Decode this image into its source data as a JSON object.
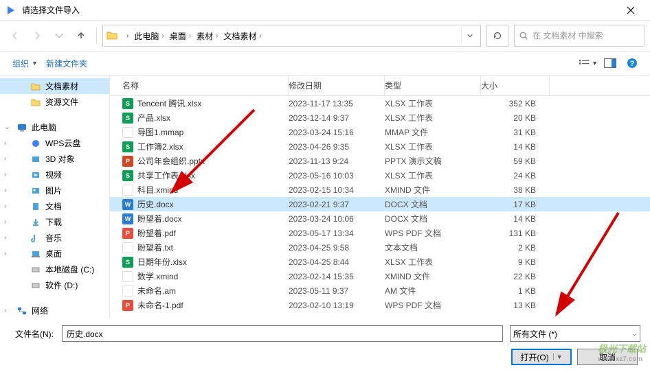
{
  "title": "请选择文件导入",
  "breadcrumb": [
    "此电脑",
    "桌面",
    "素材",
    "文档素材"
  ],
  "search_placeholder": "在 文档素材 中搜索",
  "toolbar": {
    "organize": "组织",
    "new_folder": "新建文件夹"
  },
  "sidebar": {
    "top": [
      {
        "label": "文档素材",
        "icon": "folder",
        "selected": true
      },
      {
        "label": "资源文件",
        "icon": "folder"
      }
    ],
    "pc_label": "此电脑",
    "pc_items": [
      {
        "label": "WPS云盘",
        "color": "#3d7eff"
      },
      {
        "label": "3D 对象",
        "color": "#2b7cd3"
      },
      {
        "label": "视频",
        "color": "#2b7cd3"
      },
      {
        "label": "图片",
        "color": "#2b7cd3"
      },
      {
        "label": "文档",
        "color": "#2b7cd3"
      },
      {
        "label": "下载",
        "color": "#2b7cd3"
      },
      {
        "label": "音乐",
        "color": "#2b7cd3"
      },
      {
        "label": "桌面",
        "color": "#2b7cd3"
      },
      {
        "label": "本地磁盘 (C:)",
        "color": "#888"
      },
      {
        "label": "软件 (D:)",
        "color": "#888"
      }
    ],
    "network_label": "网络"
  },
  "columns": {
    "name": "名称",
    "date": "修改日期",
    "type": "类型",
    "size": "大小"
  },
  "files": [
    {
      "name": "Tencent 腾讯.xlsx",
      "date": "2023-11-17 13:35",
      "type": "XLSX 工作表",
      "size": "352 KB",
      "icon": "xlsx",
      "glyph": "S"
    },
    {
      "name": "产品.xlsx",
      "date": "2023-12-14 9:37",
      "type": "XLSX 工作表",
      "size": "20 KB",
      "icon": "xlsx",
      "glyph": "S"
    },
    {
      "name": "导图1.mmap",
      "date": "2023-03-24 15:16",
      "type": "MMAP 文件",
      "size": "31 KB",
      "icon": "mmap",
      "glyph": ""
    },
    {
      "name": "工作簿2.xlsx",
      "date": "2023-04-26 9:35",
      "type": "XLSX 工作表",
      "size": "14 KB",
      "icon": "xlsx",
      "glyph": "S"
    },
    {
      "name": "公司年会组织.pptx",
      "date": "2023-11-13 9:24",
      "type": "PPTX 演示文稿",
      "size": "59 KB",
      "icon": "pptx",
      "glyph": "P"
    },
    {
      "name": "共享工作表.xlsx",
      "date": "2023-05-16 10:03",
      "type": "XLSX 工作表",
      "size": "24 KB",
      "icon": "xlsx",
      "glyph": "S"
    },
    {
      "name": "科目.xmind",
      "date": "2023-02-15 10:34",
      "type": "XMIND 文件",
      "size": "38 KB",
      "icon": "xmind",
      "glyph": ""
    },
    {
      "name": "历史.docx",
      "date": "2023-02-21 9:37",
      "type": "DOCX 文档",
      "size": "17 KB",
      "icon": "docx",
      "glyph": "W",
      "selected": true
    },
    {
      "name": "盼望着.docx",
      "date": "2023-03-24 10:06",
      "type": "DOCX 文档",
      "size": "14 KB",
      "icon": "docx",
      "glyph": "W"
    },
    {
      "name": "盼望着.pdf",
      "date": "2023-05-17 13:34",
      "type": "WPS PDF 文档",
      "size": "131 KB",
      "icon": "pdf",
      "glyph": "P"
    },
    {
      "name": "盼望着.txt",
      "date": "2023-04-25 9:58",
      "type": "文本文档",
      "size": "2 KB",
      "icon": "txt",
      "glyph": ""
    },
    {
      "name": "日期年份.xlsx",
      "date": "2023-04-25 8:44",
      "type": "XLSX 工作表",
      "size": "9 KB",
      "icon": "xlsx",
      "glyph": "S"
    },
    {
      "name": "数学.xmind",
      "date": "2023-02-14 15:35",
      "type": "XMIND 文件",
      "size": "22 KB",
      "icon": "xmind",
      "glyph": ""
    },
    {
      "name": "未命名.am",
      "date": "2023-05-11 9:37",
      "type": "AM 文件",
      "size": "1 KB",
      "icon": "am",
      "glyph": ""
    },
    {
      "name": "未命名-1.pdf",
      "date": "2023-02-10 13:19",
      "type": "WPS PDF 文档",
      "size": "13 KB",
      "icon": "pdf",
      "glyph": "P"
    }
  ],
  "filename_label": "文件名(N):",
  "filename_value": "历史.docx",
  "filter_label": "所有文件 (*)",
  "buttons": {
    "open": "打开(O)",
    "cancel": "取消"
  },
  "watermark": {
    "main": "极光下载站",
    "sub": "www.xz7.com"
  }
}
